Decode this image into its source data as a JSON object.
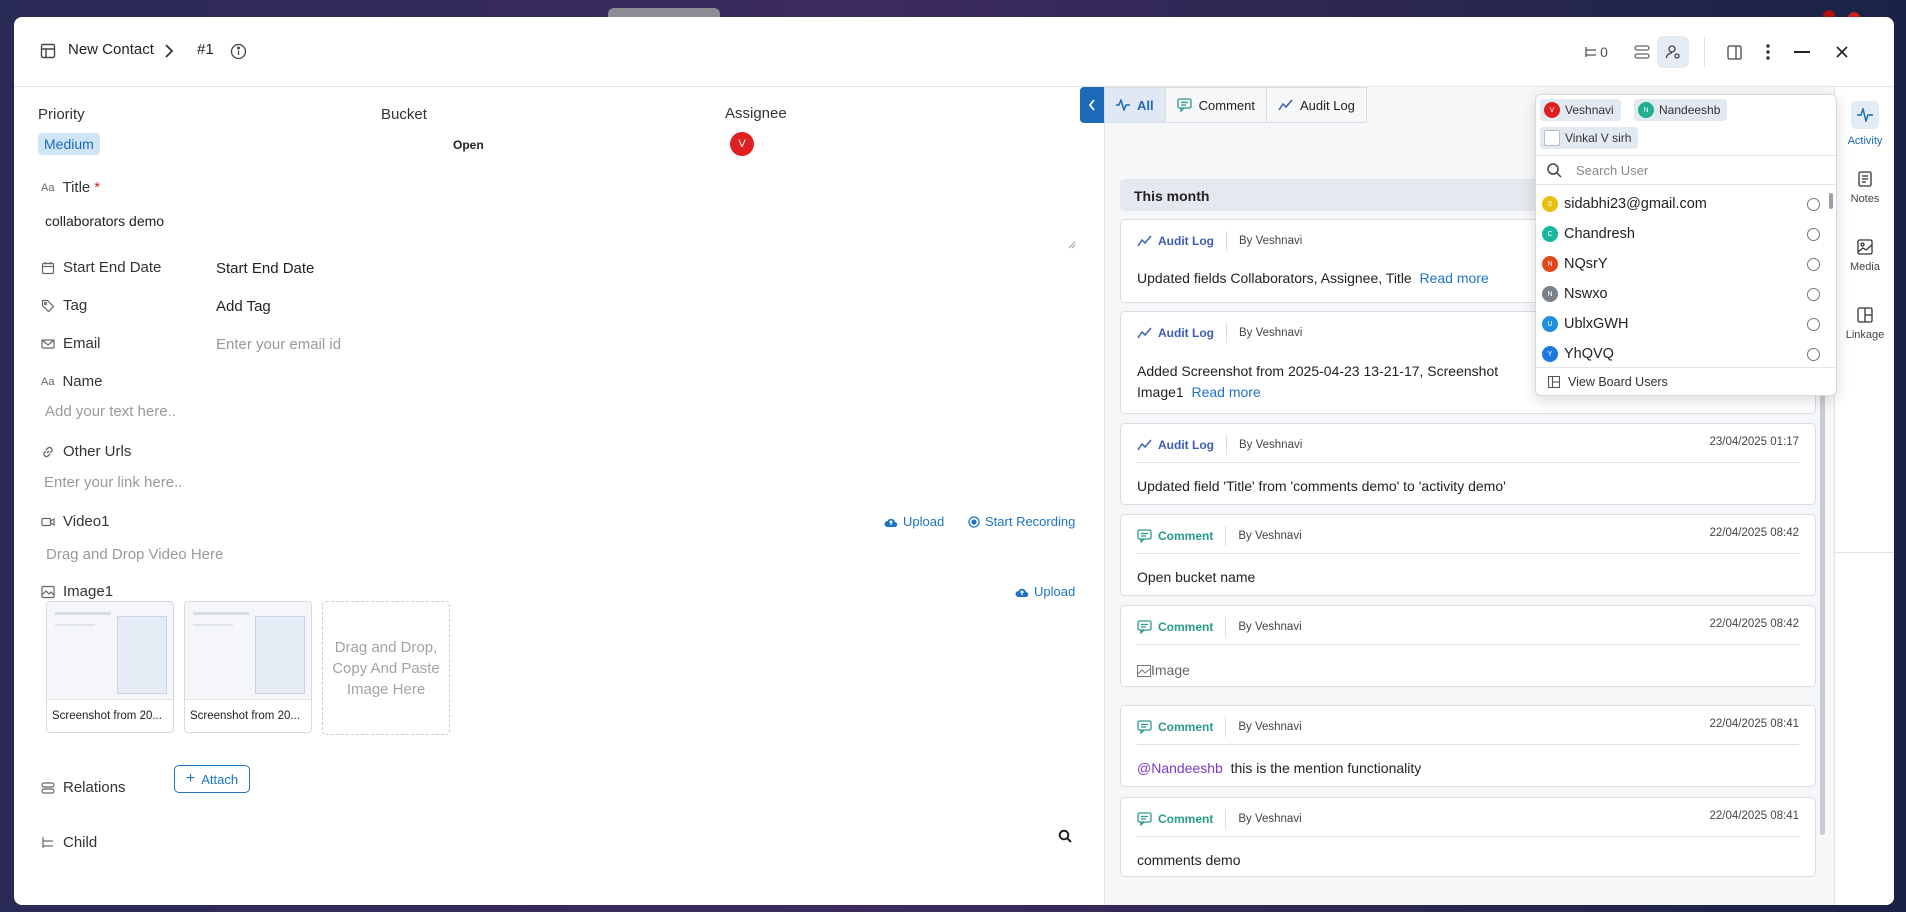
{
  "header": {
    "title": "New Contact",
    "record_id": "#1",
    "child_count": "0"
  },
  "fields": {
    "priority_label": "Priority",
    "priority_value": "Medium",
    "bucket_label": "Bucket",
    "bucket_value": "Open",
    "assignee_label": "Assignee",
    "assignee_initial": "V",
    "title_label": "Title",
    "title_required": "*",
    "title_value": "collaborators demo",
    "date_label": "Start End Date",
    "date_value": "Start End Date",
    "tag_label": "Tag",
    "tag_value": "Add Tag",
    "email_label": "Email",
    "email_placeholder": "Enter your email id",
    "name_label": "Name",
    "name_placeholder": "Add your text here..",
    "urls_label": "Other Urls",
    "urls_placeholder": "Enter your link here..",
    "video_label": "Video1",
    "video_upload": "Upload",
    "video_record": "Start Recording",
    "video_placeholder": "Drag and Drop Video Here",
    "image_label": "Image1",
    "image_upload": "Upload",
    "thumb1_caption": "Screenshot from 20...",
    "thumb2_caption": "Screenshot from 20...",
    "image_drop": "Drag and Drop, Copy And Paste Image Here",
    "relations_label": "Relations",
    "attach_label": "Attach",
    "child_label": "Child"
  },
  "activity": {
    "tabs": [
      "All",
      "Comment",
      "Audit Log"
    ],
    "month": "This month",
    "cards": [
      {
        "type": "Audit Log",
        "by": "By Veshnavi",
        "date": "",
        "text": "Updated fields Collaborators, Assignee, Title",
        "more": "Read more"
      },
      {
        "type": "Audit Log",
        "by": "By Veshnavi",
        "date": "",
        "text": "Added Screenshot from 2025-04-23 13-21-17, Screenshot",
        "text2": "Image1",
        "more": "Read more"
      },
      {
        "type": "Audit Log",
        "by": "By Veshnavi",
        "date": "23/04/2025 01:17",
        "text": "Updated field 'Title' from 'comments demo' to 'activity demo'"
      },
      {
        "type": "Comment",
        "by": "By Veshnavi",
        "date": "22/04/2025 08:42",
        "text": "Open bucket name"
      },
      {
        "type": "Comment",
        "by": "By Veshnavi",
        "date": "22/04/2025 08:42",
        "text": "Image"
      },
      {
        "type": "Comment",
        "by": "By Veshnavi",
        "date": "22/04/2025 08:41",
        "mention": "@Nandeeshb",
        "text": "this is the mention functionality"
      },
      {
        "type": "Comment",
        "by": "By Veshnavi",
        "date": "22/04/2025 08:41",
        "text": "comments demo"
      }
    ]
  },
  "rail": [
    "Activity",
    "Notes",
    "Media",
    "Linkage"
  ],
  "dropdown": {
    "selected": [
      {
        "name": "Veshnavi",
        "color": "#e02020",
        "initial": "V"
      },
      {
        "name": "Nandeeshb",
        "color": "#20b090",
        "initial": "N"
      },
      {
        "name": "Vinkal V sirh",
        "color": "#9aa0a8",
        "initial": ""
      }
    ],
    "search_placeholder": "Search User",
    "users": [
      {
        "name": "sidabhi23@gmail.com",
        "color": "#e8c010",
        "initial": "S"
      },
      {
        "name": "Chandresh",
        "color": "#18b8a0",
        "initial": "C"
      },
      {
        "name": "NQsrY",
        "color": "#e04818",
        "initial": "N"
      },
      {
        "name": "Nswxo",
        "color": "#7a8088",
        "initial": "N"
      },
      {
        "name": "UblxGWH",
        "color": "#1d8ee0",
        "initial": "U"
      },
      {
        "name": "YhQVQ",
        "color": "#1d78e0",
        "initial": "Y"
      }
    ],
    "footer": "View Board Users"
  }
}
